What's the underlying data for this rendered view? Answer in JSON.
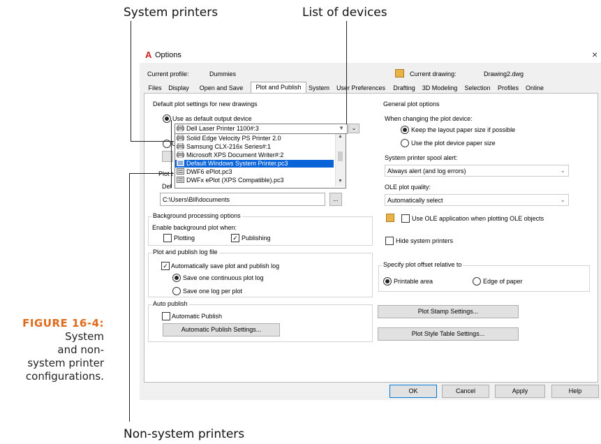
{
  "callouts": {
    "system_printers": "System printers",
    "list_of_devices": "List of devices",
    "non_system_printers": "Non-system printers"
  },
  "caption": {
    "number": "FIGURE 16-4:",
    "line1": "System",
    "line2": "and non-",
    "line3": "system printer",
    "line4": "configurations."
  },
  "window": {
    "title": "Options",
    "close": "×"
  },
  "profile": {
    "label": "Current profile:",
    "value": "Dummies",
    "drawing_label": "Current drawing:",
    "drawing_value": "Drawing2.dwg"
  },
  "tabs": [
    "Files",
    "Display",
    "Open and Save",
    "Plot and Publish",
    "System",
    "User Preferences",
    "Drafting",
    "3D Modeling",
    "Selection",
    "Profiles",
    "Online"
  ],
  "default_plot": {
    "legend": "Default plot settings for new drawings",
    "use_default_label": "Use as default output device",
    "selected_device": "Dell Laser Printer 1100#:3",
    "devices": [
      "Solid Edge Velocity PS Printer 2.0",
      "Samsung CLX-216x Series#:1",
      "Microsoft XPS Document Writer#:2",
      "Default Windows System Printer.pc3",
      "DWF6 ePlot.pc3",
      "DWFx ePlot (XPS Compatible).pc3"
    ],
    "radio2_fragment": "U",
    "plot_fragment": "Plot t",
    "def_fragment": "Def",
    "path": "C:\\Users\\Bill\\documents",
    "browse": "..."
  },
  "background": {
    "legend": "Background processing options",
    "enable_label": "Enable background plot when:",
    "plotting": "Plotting",
    "publishing": "Publishing"
  },
  "log": {
    "legend": "Plot and publish log file",
    "auto_save": "Automatically save plot and publish log",
    "continuous": "Save one continuous plot log",
    "per_plot": "Save one log per plot"
  },
  "auto_publish": {
    "legend": "Auto publish",
    "auto": "Automatic Publish",
    "settings_button": "Automatic Publish Settings..."
  },
  "general": {
    "legend": "General plot options",
    "changing_label": "When changing the plot device:",
    "keep_layout": "Keep the layout paper size if possible",
    "use_device": "Use the plot device paper size",
    "spool_label": "System printer spool alert:",
    "spool_value": "Always alert (and log errors)",
    "ole_label": "OLE plot quality:",
    "ole_value": "Automatically select",
    "use_ole": "Use OLE application when plotting OLE objects",
    "hide_printers": "Hide system printers"
  },
  "offset": {
    "legend": "Specify plot offset relative to",
    "printable": "Printable area",
    "edge": "Edge of paper"
  },
  "buttons": {
    "stamp": "Plot Stamp Settings...",
    "style_table": "Plot Style Table Settings...",
    "ok": "OK",
    "cancel": "Cancel",
    "apply": "Apply",
    "help": "Help"
  },
  "colors": {
    "accent": "#cc1f1f",
    "selection": "#0a64d8",
    "caption_orange": "#e06a1b"
  }
}
